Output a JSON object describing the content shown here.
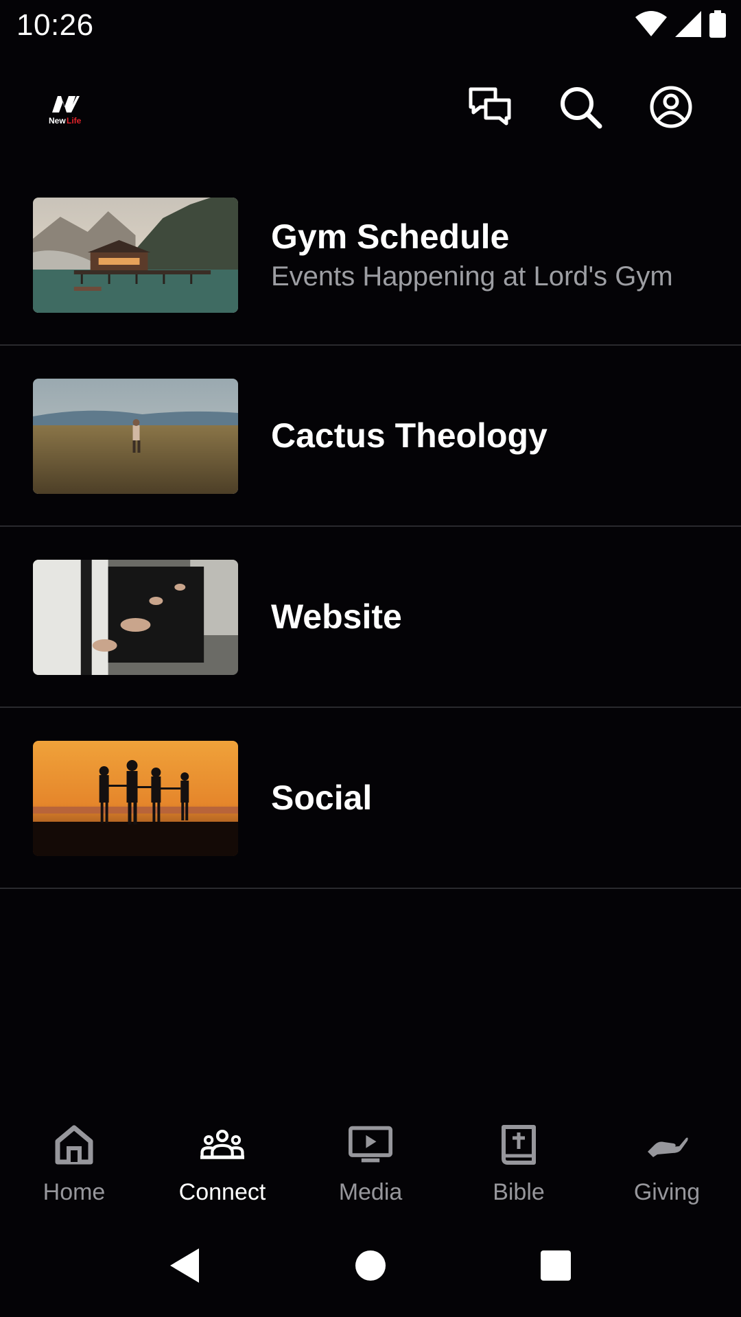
{
  "status_bar": {
    "time": "10:26"
  },
  "header": {
    "logo_text": "NewLife",
    "icons": [
      "chat-icon",
      "search-icon",
      "account-icon"
    ]
  },
  "items": [
    {
      "title": "Gym Schedule",
      "subtitle": "Events Happening at Lord's Gym"
    },
    {
      "title": "Cactus Theology",
      "subtitle": ""
    },
    {
      "title": "Website",
      "subtitle": ""
    },
    {
      "title": "Social",
      "subtitle": ""
    }
  ],
  "nav": [
    {
      "label": "Home",
      "icon": "home-icon",
      "active": false
    },
    {
      "label": "Connect",
      "icon": "people-icon",
      "active": true
    },
    {
      "label": "Media",
      "icon": "media-icon",
      "active": false
    },
    {
      "label": "Bible",
      "icon": "bible-icon",
      "active": false
    },
    {
      "label": "Giving",
      "icon": "giving-icon",
      "active": false
    }
  ],
  "colors": {
    "background": "#040306",
    "active": "#ffffff",
    "inactive": "#97979c",
    "divider": "#2a2a2e"
  }
}
